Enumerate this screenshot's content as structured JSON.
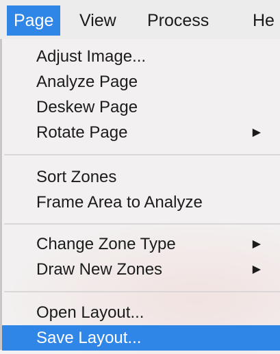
{
  "menubar": {
    "items": [
      {
        "label": "Page",
        "active": true
      },
      {
        "label": "View"
      },
      {
        "label": "Process"
      },
      {
        "label": "He"
      }
    ]
  },
  "menu": {
    "items": [
      {
        "label": "Adjust Image..."
      },
      {
        "label": "Analyze Page"
      },
      {
        "label": "Deskew Page"
      },
      {
        "label": "Rotate Page",
        "submenu": true
      },
      {
        "label": "Sort Zones"
      },
      {
        "label": "Frame Area to Analyze"
      },
      {
        "label": "Change Zone Type",
        "submenu": true
      },
      {
        "label": "Draw New Zones",
        "submenu": true
      },
      {
        "label": "Open Layout..."
      },
      {
        "label": "Save Layout...",
        "highlighted": true
      }
    ],
    "submenu_arrow": "▶"
  },
  "colors": {
    "accent": "#2f86e6",
    "menu_bg": "#f2f0f0"
  }
}
